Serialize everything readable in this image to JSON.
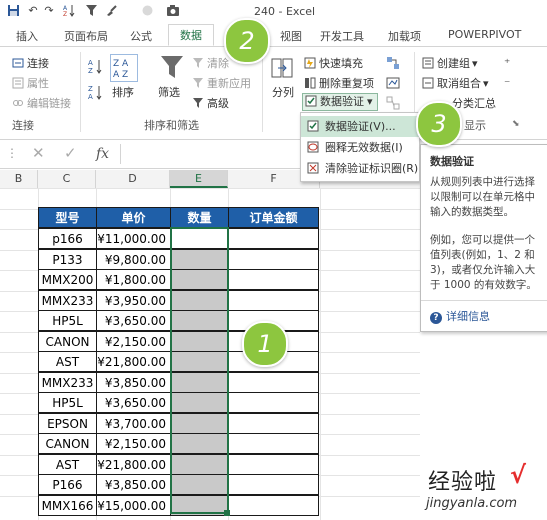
{
  "window": {
    "title": "240 - Excel"
  },
  "qat": {
    "save_icon": "save-icon",
    "undo": "↶",
    "redo": "↷",
    "sort_icon": "sort-az-icon",
    "filter_icon": "filter-icon",
    "camera_icon": "camera-icon"
  },
  "tabs": [
    "插入",
    "页面布局",
    "公式",
    "数据",
    "视图",
    "开发工具",
    "加载项",
    "POWERPIVOT"
  ],
  "ribbon": {
    "connections": {
      "connect": "连接",
      "properties": "属性",
      "edit_links": "编辑链接",
      "label": "连接"
    },
    "sort_filter": {
      "sort": "排序",
      "filter": "筛选",
      "clear": "清除",
      "reapply": "重新应用",
      "advanced": "高级",
      "label": "排序和筛选"
    },
    "data_tools": {
      "split": "分列",
      "flash_fill": "快速填充",
      "remove_dup": "删除重复项",
      "validation": "数据验证"
    },
    "outline": {
      "group": "创建组",
      "ungroup": "取消组合",
      "subtotal": "分类汇总",
      "show_detail": "显示",
      "label": "分级显示"
    }
  },
  "validation_menu": [
    "数据验证(V)...",
    "圈释无效数据(I)",
    "清除验证标识圈(R)"
  ],
  "tooltip": {
    "title": "数据验证",
    "p1": "从规则列表中进行选择以限制可以在单元格中输入的数据类型。",
    "p2": "例如，您可以提供一个值列表(例如，1、2 和 3)，或者仅允许输入大于 1000 的有效数字。",
    "help": "详细信息"
  },
  "formula_bar": {
    "fx": "fx",
    "cancel": "✕",
    "enter": "✓"
  },
  "columns": [
    "B",
    "C",
    "D",
    "E",
    "F"
  ],
  "table": {
    "headers": [
      "型号",
      "单价",
      "数量",
      "订单金额"
    ],
    "rows": [
      [
        "p166",
        "¥11,000.00"
      ],
      [
        "P133",
        "¥9,800.00"
      ],
      [
        "MMX200",
        "¥1,800.00"
      ],
      [
        "MMX233",
        "¥3,950.00"
      ],
      [
        "HP5L",
        "¥3,650.00"
      ],
      [
        "CANON",
        "¥2,150.00"
      ],
      [
        "AST",
        "¥21,800.00"
      ],
      [
        "MMX233",
        "¥3,850.00"
      ],
      [
        "HP5L",
        "¥3,650.00"
      ],
      [
        "EPSON",
        "¥3,700.00"
      ],
      [
        "CANON",
        "¥2,150.00"
      ],
      [
        "AST",
        "¥21,800.00"
      ],
      [
        "P166",
        "¥3,850.00"
      ],
      [
        "MMX166",
        "¥15,000.00"
      ]
    ]
  },
  "callouts": [
    "1",
    "2",
    "3"
  ],
  "watermark": {
    "brand": "经验啦",
    "check": "√",
    "url": "jingyanla.com"
  },
  "colors": {
    "accent": "#217346",
    "header_blue": "#1f5fa8",
    "callout_green": "#8dc63f",
    "selection_gray": "#c9c9c9"
  }
}
